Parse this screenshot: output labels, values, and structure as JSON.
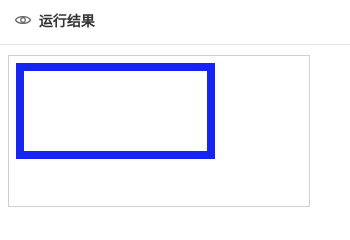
{
  "header": {
    "title": "运行结果",
    "icon": "eye-icon"
  },
  "result_canvas": {
    "shape": "rectangle",
    "stroke_color": "#1624f2",
    "fill": "none"
  }
}
